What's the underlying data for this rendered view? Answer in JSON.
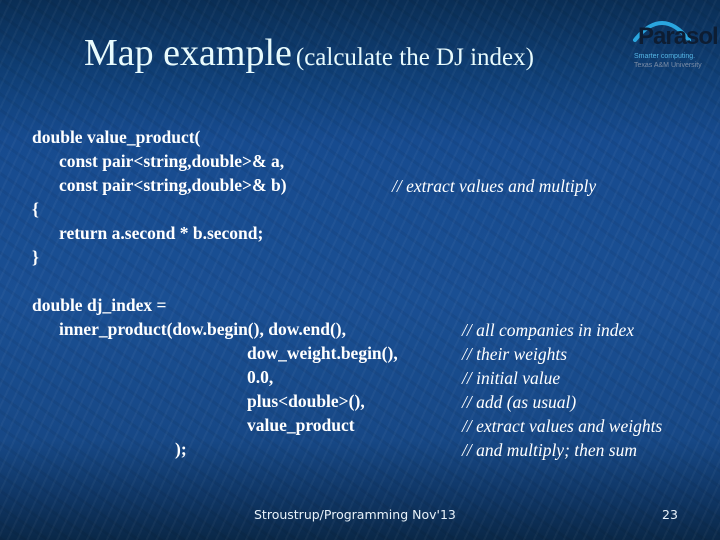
{
  "slide": {
    "title": {
      "main": "Map example",
      "sub": "(calculate the DJ index)"
    },
    "logo": {
      "name": "Parasol",
      "tagline_1": "Smarter computing.",
      "tagline_2": "Texas A&M University"
    },
    "code_block_1": {
      "lines": [
        "double value_product(",
        "const pair<string,double>& a,",
        "const pair<string,double>& b)",
        "{",
        "return a.second * b.second;",
        "}"
      ],
      "comment": "// extract values and multiply"
    },
    "code_block_2": {
      "lines": [
        "double dj_index =",
        "inner_product(dow.begin(), dow.end(),",
        "dow_weight.begin(),",
        "0.0,",
        "plus<double>(),",
        "value_product",
        ");"
      ],
      "comments": [
        "// all companies in index",
        "// their weights",
        "// initial value",
        "// add (as usual)",
        "// extract values and weights",
        "// and multiply; then sum"
      ]
    },
    "footer": {
      "text": "Stroustrup/Programming Nov'13",
      "page_number": "23"
    }
  }
}
